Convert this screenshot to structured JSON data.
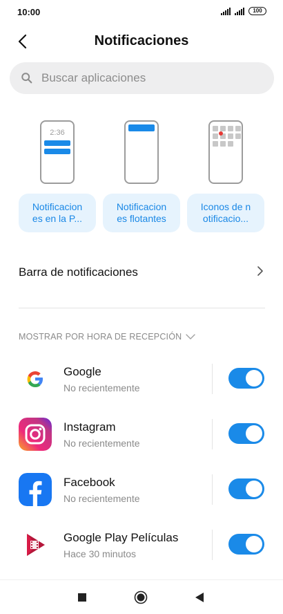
{
  "status": {
    "time": "10:00",
    "battery": "100"
  },
  "header": {
    "title": "Notificaciones"
  },
  "search": {
    "placeholder": "Buscar aplicaciones"
  },
  "styles": {
    "preview_time": "2:36",
    "lockscreen_label": "Notificaciones en la P...",
    "floating_label": "Notificaciones flotantes",
    "badges_label": "Iconos de notificacio..."
  },
  "settings": {
    "notification_bar_label": "Barra de notificaciones"
  },
  "sort": {
    "label": "MOSTRAR POR HORA DE RECEPCIÓN"
  },
  "apps": [
    {
      "name": "Google",
      "subtitle": "No recientemente",
      "icon": "google-icon",
      "enabled": true
    },
    {
      "name": "Instagram",
      "subtitle": "No recientemente",
      "icon": "instagram-icon",
      "enabled": true
    },
    {
      "name": "Facebook",
      "subtitle": "No recientemente",
      "icon": "facebook-icon",
      "enabled": true
    },
    {
      "name": "Google Play Películas",
      "subtitle": "Hace 30 minutos",
      "icon": "play-movies-icon",
      "enabled": true
    }
  ],
  "colors": {
    "accent": "#1a8ae8",
    "chip_bg": "#e6f3fd",
    "chip_text": "#1a88e6"
  }
}
